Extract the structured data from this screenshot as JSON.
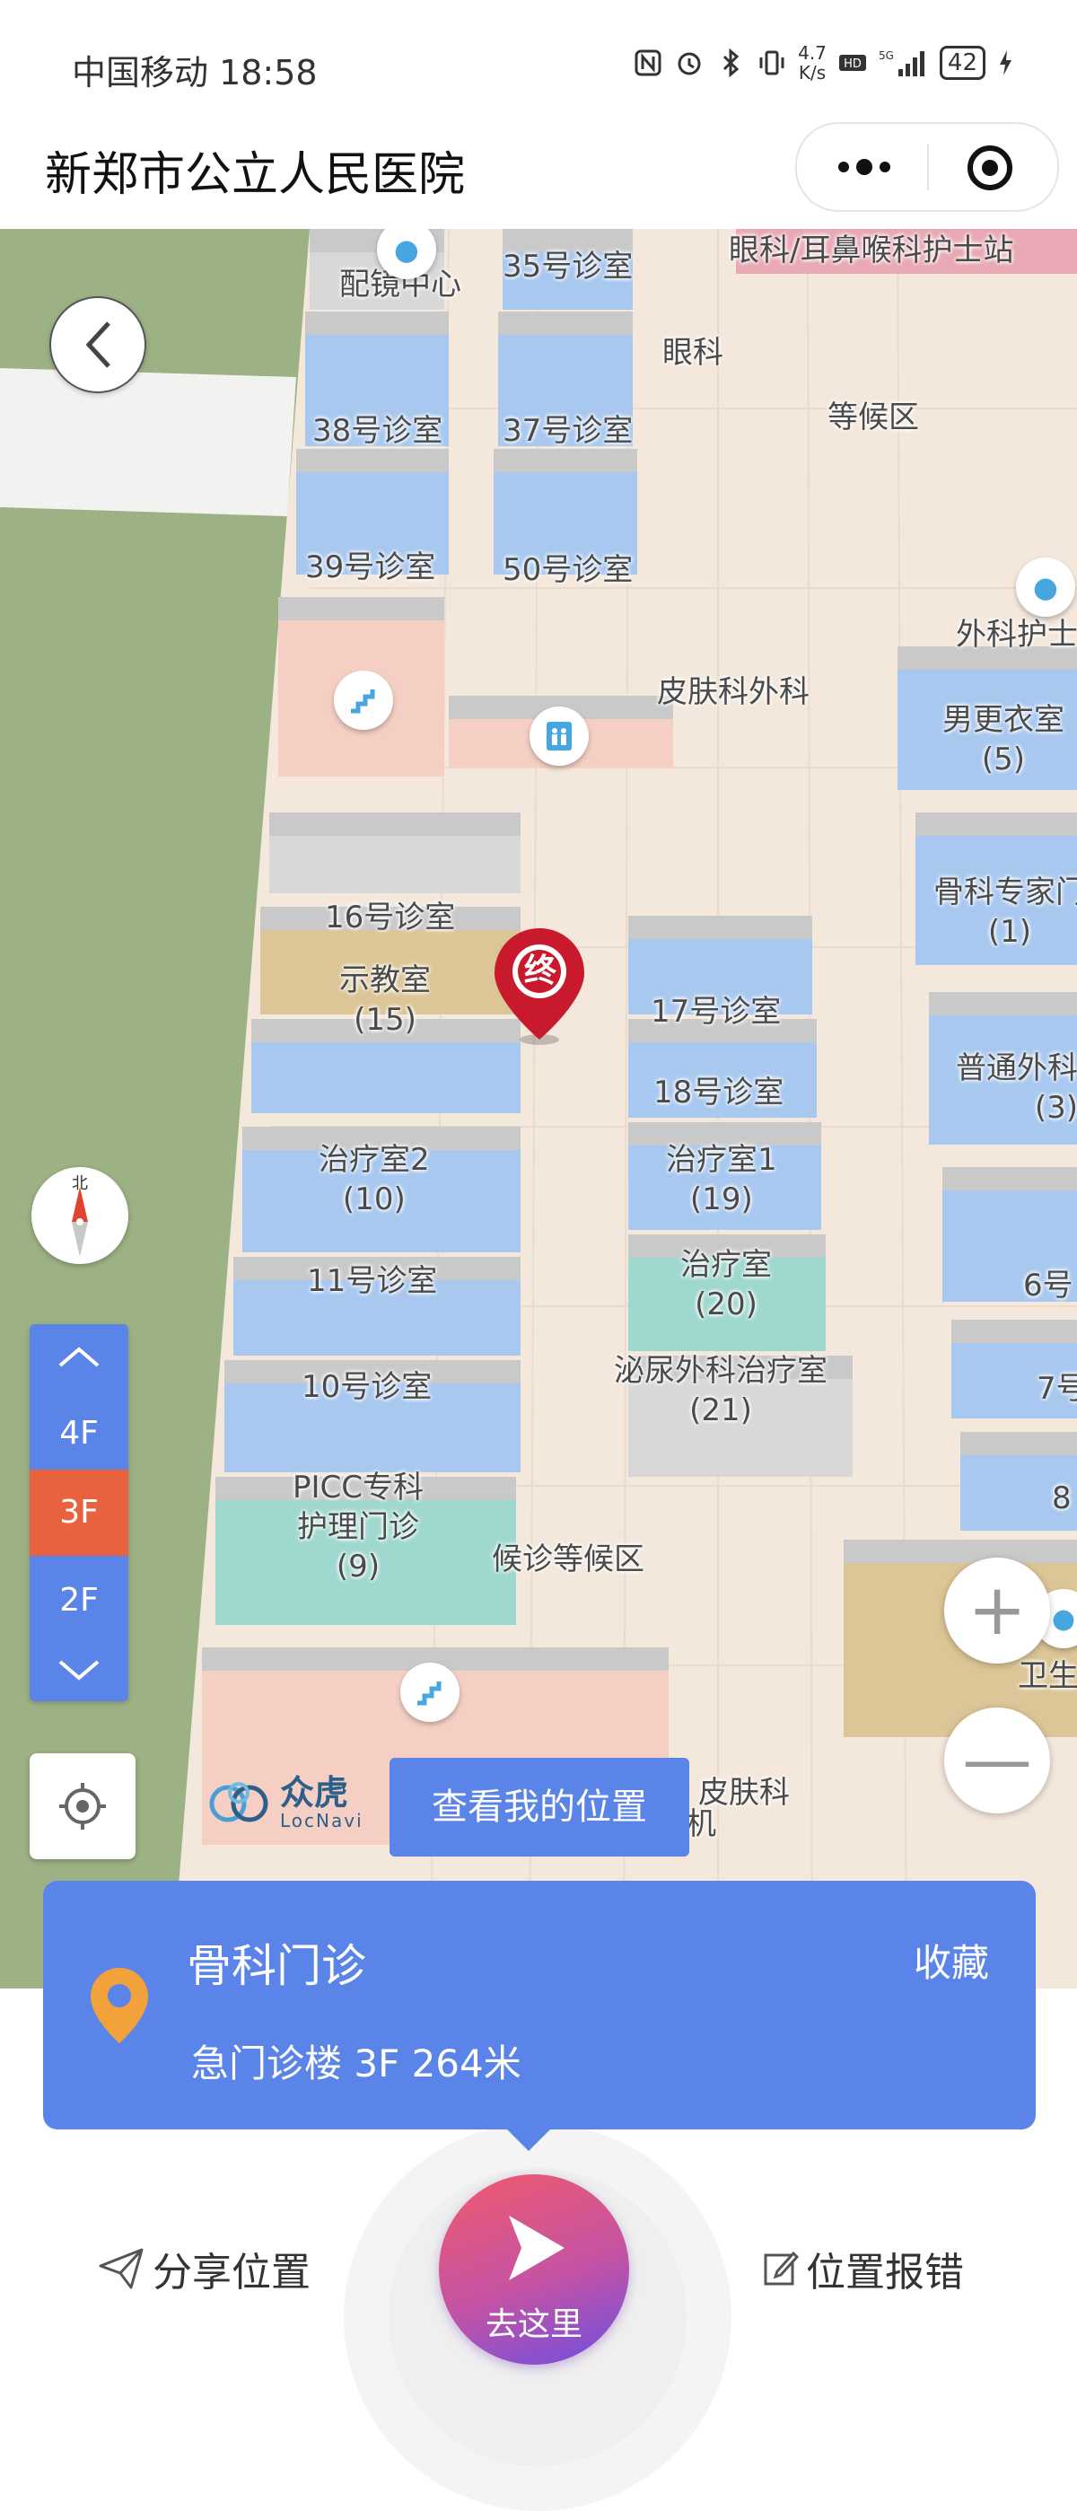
{
  "status_bar": {
    "carrier_time": "中国移动 18:58",
    "speed_top": "4.7",
    "speed_unit": "K/s",
    "battery": "42",
    "icons": [
      "nfc-icon",
      "alarm-icon",
      "bluetooth-icon",
      "vibrate-icon",
      "hd-icon",
      "5g-signal-icon",
      "charging-icon"
    ]
  },
  "title_bar": {
    "title": "新郑市公立人民医院",
    "menu_icon": "more-dots-icon",
    "close_icon": "target-close-icon"
  },
  "map": {
    "labels": {
      "glasses_center": "配镜中心",
      "room35": "35号诊室",
      "eye_ent_station": "眼科/耳鼻喉科护士站",
      "ophthalmology": "眼科",
      "waiting_area": "等候区",
      "room38": "38号诊室",
      "room37": "37号诊室",
      "room39": "39号诊室",
      "room50": "50号诊室",
      "surgery_nurse": "外科护士",
      "derm_surgery": "皮肤科外科",
      "male_locker": "男更衣室",
      "male_locker_no": "(5)",
      "room16": "16号诊室",
      "demo_room": "示教室",
      "demo_room_no": "(15)",
      "ortho_expert": "骨科专家门",
      "ortho_expert_no": "(1)",
      "room17": "17号诊室",
      "room18": "18号诊室",
      "general_surgery": "普通外科",
      "general_surgery_no": "(3)",
      "treatment2": "治疗室2",
      "treatment2_no": "(10)",
      "treatment1": "治疗室1",
      "treatment1_no": "(19)",
      "room11": "11号诊室",
      "treatment": "治疗室",
      "treatment_no": "(20)",
      "room6": "6号",
      "urology_treatment": "泌尿外科治疗室",
      "urology_treatment_no": "(21)",
      "room10": "10号诊室",
      "room7": "7号",
      "picc_line1": "PICC专科",
      "picc_line2": "护理门诊",
      "picc_no": "(9)",
      "waiting_area2": "候诊等候区",
      "room8": "8",
      "restroom": "卫生",
      "derm2": "皮肤科",
      "printer": "印机"
    },
    "destination_marker": "终",
    "compass_north": "北",
    "floors": [
      "4F",
      "3F",
      "2F"
    ],
    "active_floor": "3F",
    "zoom_in": "+",
    "zoom_out": "—",
    "logo_name": "众虎",
    "logo_sub": "LocNavi",
    "my_location_button": "查看我的位置"
  },
  "card": {
    "name": "骨科门诊",
    "detail": "急门诊楼 3F 264米",
    "favorite": "收藏"
  },
  "bottom": {
    "share": "分享位置",
    "go_here": "去这里",
    "report_error": "位置报错"
  }
}
